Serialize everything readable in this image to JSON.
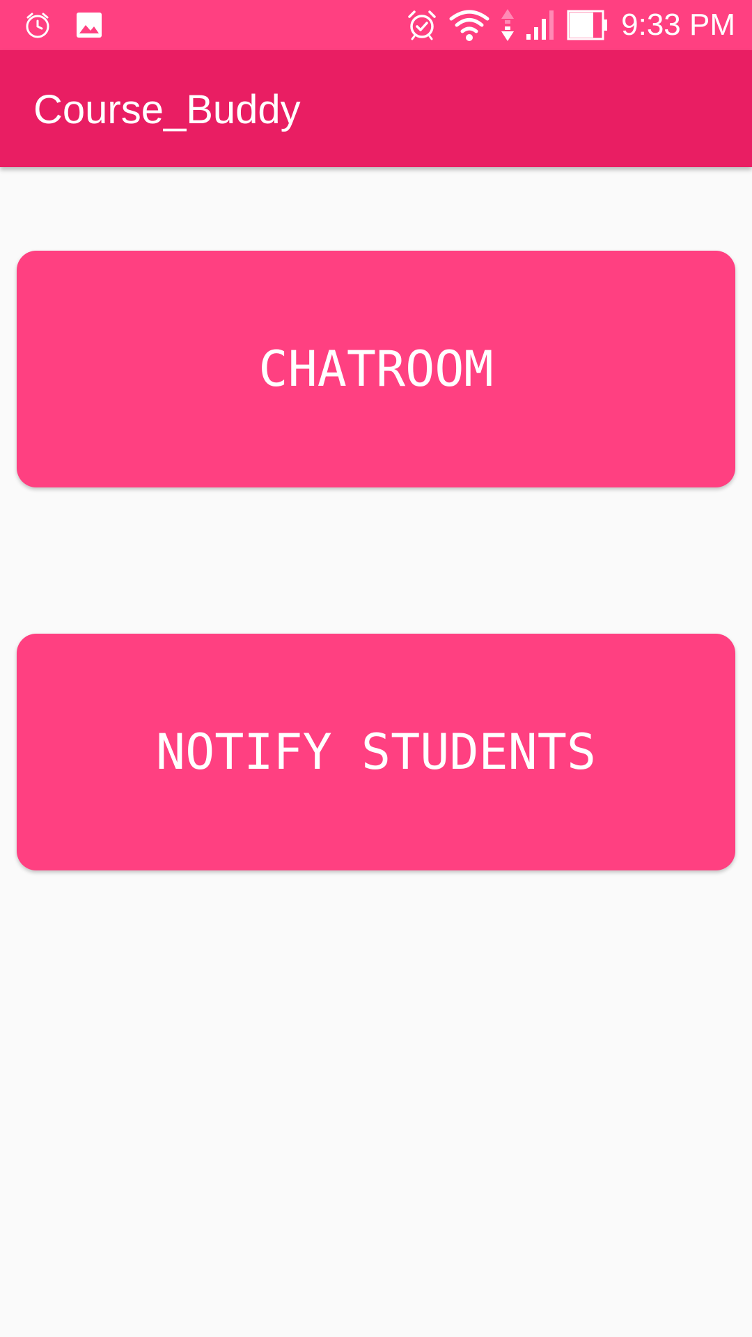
{
  "status_bar": {
    "left_icons": [
      "alarm-clock-notification-icon",
      "image-notification-icon"
    ],
    "right_icons": [
      "alarm-icon",
      "wifi-icon",
      "data-arrows-icon",
      "signal-icon",
      "battery-icon"
    ],
    "time": "9:33 PM"
  },
  "app_bar": {
    "title": "Course_Buddy"
  },
  "buttons": {
    "chatroom": "CHATROOM",
    "notify_students": "NOTIFY STUDENTS"
  },
  "colors": {
    "status_bar": "#ff4081",
    "app_bar": "#e91e63",
    "button": "#ff4081",
    "background": "#fafafa",
    "text": "#ffffff"
  }
}
